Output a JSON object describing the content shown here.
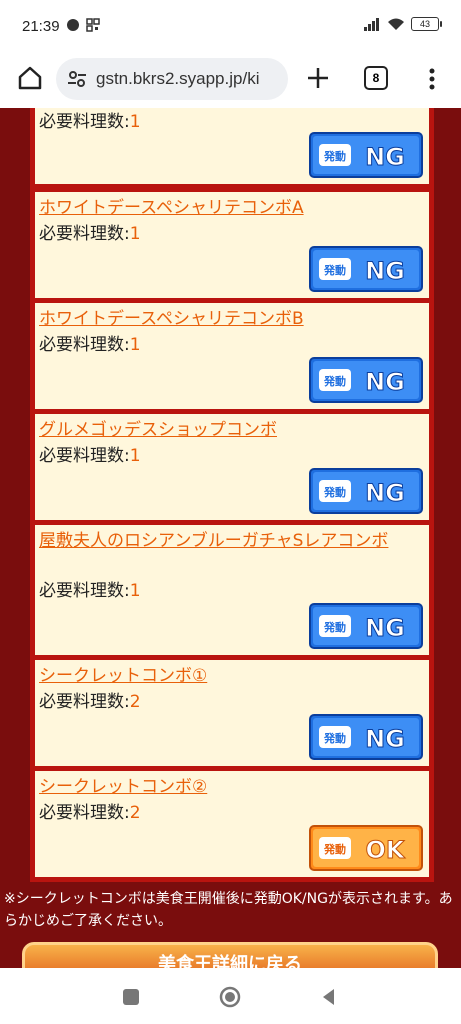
{
  "status": {
    "time": "21:39",
    "battery": "43"
  },
  "browser": {
    "url": "gstn.bkrs2.syapp.jp/ki",
    "tab_count": "8"
  },
  "requirement_prefix": "必要料理数:",
  "cards": [
    {
      "title": "",
      "required": "1",
      "status": "NG"
    },
    {
      "title": "ホワイトデースペシャリテコンボA",
      "required": "1",
      "status": "NG"
    },
    {
      "title": "ホワイトデースペシャリテコンボB",
      "required": "1",
      "status": "NG"
    },
    {
      "title": "グルメゴッデスショップコンボ",
      "required": "1",
      "status": "NG"
    },
    {
      "title": "屋敷夫人のロシアンブルーガチャSレアコンボ",
      "required": "1",
      "status": "NG"
    },
    {
      "title": "シークレットコンボ①",
      "required": "2",
      "status": "NG"
    },
    {
      "title": "シークレットコンボ②",
      "required": "2",
      "status": "OK"
    }
  ],
  "badge_label": "発動",
  "note": "※シークレットコンボは美食王開催後に発動OK/NGが表示されます。あらかじめご了承ください。",
  "back_button": "美食王詳細に戻る",
  "colors": {
    "bg_dark": "#7a0d0d",
    "panel_red": "#b9140f",
    "card_bg": "#fff7dc",
    "link_orange": "#e8600a",
    "ng_blue": "#1f6fe0",
    "ok_orange": "#ff8a1a"
  }
}
